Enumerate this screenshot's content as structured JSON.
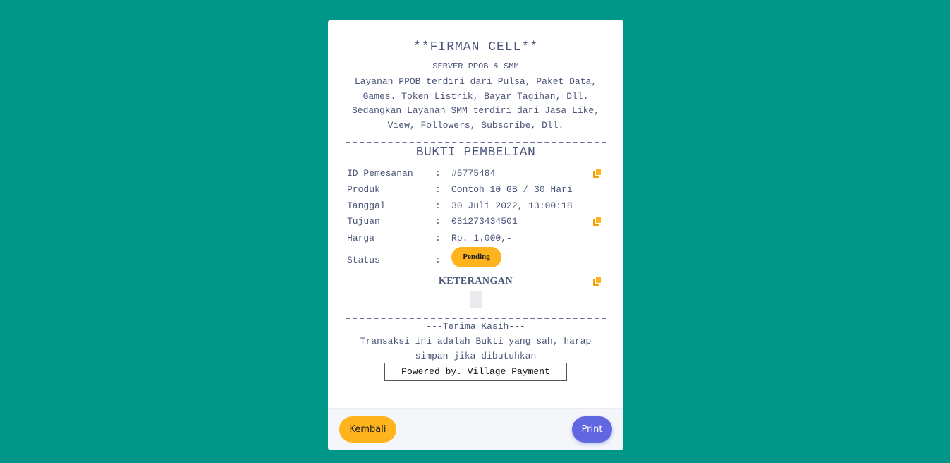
{
  "colors": {
    "background": "#009688",
    "accent_yellow": "#ffb41e",
    "accent_blue": "#6067e0",
    "text": "#4a5478"
  },
  "shop": {
    "name": "**FIRMAN CELL**",
    "subtitle": "SERVER PPOB & SMM",
    "description": "Layanan PPOB terdiri dari Pulsa, Paket Data, Games. Token Listrik, Bayar Tagihan, Dll. Sedangkan Layanan SMM terdiri dari Jasa Like, View, Followers, Subscribe, Dll."
  },
  "receipt": {
    "title": "BUKTI PEMBELIAN",
    "separator": ":",
    "rows": [
      {
        "label": "ID Pemesanan",
        "value": "#5775484",
        "copy_icon": "copy-icon"
      },
      {
        "label": "Produk",
        "value": "Contoh 10 GB / 30 Hari"
      },
      {
        "label": "Tanggal",
        "value": "30 Juli 2022, 13:00:18"
      },
      {
        "label": "Tujuan",
        "value": "081273434501",
        "copy_icon": "copy-icon"
      },
      {
        "label": "Harga",
        "value": "Rp. 1.000,-"
      }
    ],
    "status": {
      "label": "Status",
      "value": "Pending"
    },
    "keterangan": {
      "title": "KETERANGAN",
      "value": "",
      "copy_icon": "copy-icon"
    },
    "thanks": "---Terima Kasih---",
    "note": "Transaksi ini adalah Bukti yang sah, harap simpan jika dibutuhkan",
    "powered_by": "Powered by. Village Payment"
  },
  "footer": {
    "back_label": "Kembali",
    "print_label": "Print"
  }
}
